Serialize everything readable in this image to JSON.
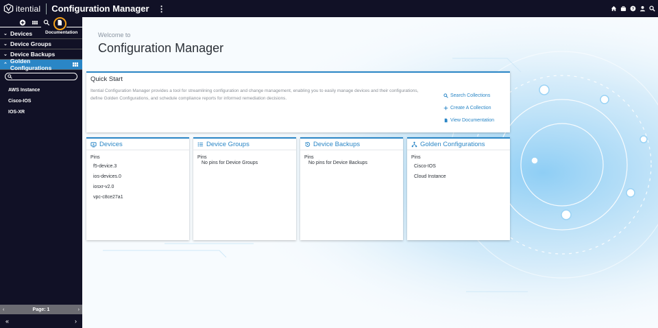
{
  "topbar": {
    "brand": "itential",
    "app_title": "Configuration Manager",
    "kebab": "⋮",
    "icons": [
      "home-icon",
      "briefcase-icon",
      "help-icon",
      "user-icon",
      "search-icon"
    ]
  },
  "sidebar": {
    "tools": [
      "add-icon",
      "grid-icon",
      "search-icon",
      "document-icon"
    ],
    "tooltip": "Documentation",
    "nav": [
      {
        "label": "Devices",
        "expanded": false
      },
      {
        "label": "Device Groups",
        "expanded": false
      },
      {
        "label": "Device Backups",
        "expanded": false
      },
      {
        "label": "Golden Configurations",
        "expanded": true
      }
    ],
    "search_placeholder": "",
    "items": [
      "AWS Instance",
      "Cisco-IOS",
      "IOS-XR"
    ],
    "pager": {
      "prev": "‹",
      "label": "Page: 1",
      "next": "›"
    },
    "collapse": {
      "left": "«",
      "right": "›"
    }
  },
  "main": {
    "welcome": "Welcome to",
    "title": "Configuration Manager",
    "quick_start": {
      "title": "Quick Start",
      "description": "Itential Configuration Manager provides a tool for streamlining configuration and change management, enabling you to easily manage devices and their configurations, define Golden Configurations, and schedule compliance reports for informed remediation decisions.",
      "links": [
        "Search Collections",
        "Create A Collection",
        "View Documentation"
      ]
    },
    "panels": [
      {
        "title": "Devices",
        "pins_label": "Pins",
        "pins": [
          "f5-device.3",
          "ios-devices.0",
          "iosxr-v2.0",
          "vpc-c8ce27a1"
        ],
        "empty": ""
      },
      {
        "title": "Device Groups",
        "pins_label": "Pins",
        "pins": [],
        "empty": "No pins for Device Groups"
      },
      {
        "title": "Device Backups",
        "pins_label": "Pins",
        "pins": [],
        "empty": "No pins for Device Backups"
      },
      {
        "title": "Golden Configurations",
        "pins_label": "Pins",
        "pins": [
          "Cisco-IOS",
          "Cloud Instance"
        ],
        "empty": ""
      }
    ]
  },
  "colors": {
    "accent": "#2a86c6",
    "nav_bg": "#111126",
    "highlight": "#f6a21b"
  }
}
